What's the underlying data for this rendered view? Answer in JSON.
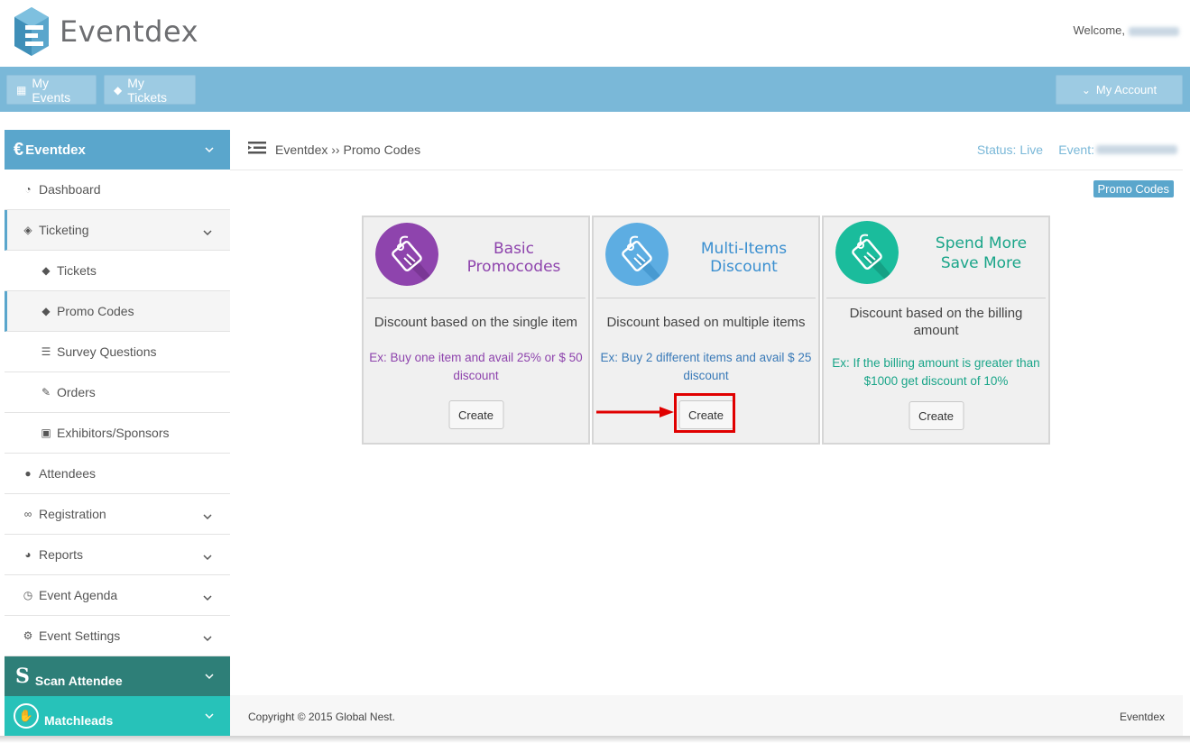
{
  "header": {
    "brand": "Eventdex",
    "welcome": "Welcome,"
  },
  "nav": {
    "my_events": "My Events",
    "my_tickets": "My Tickets",
    "my_account": "My Account"
  },
  "sidebar": {
    "brand": "Eventdex",
    "items": [
      {
        "label": "Dashboard",
        "icon": "dashboard-icon"
      },
      {
        "label": "Ticketing",
        "icon": "ticket-icon"
      },
      {
        "label": "Tickets",
        "icon": "tags-icon"
      },
      {
        "label": "Promo Codes",
        "icon": "tags-icon"
      },
      {
        "label": "Survey Questions",
        "icon": "list-icon"
      },
      {
        "label": "Orders",
        "icon": "edit-icon"
      },
      {
        "label": "Exhibitors/Sponsors",
        "icon": "cube-icon"
      },
      {
        "label": "Attendees",
        "icon": "user-icon"
      },
      {
        "label": "Registration",
        "icon": "link-icon"
      },
      {
        "label": "Reports",
        "icon": "pie-chart-icon"
      },
      {
        "label": "Event Agenda",
        "icon": "clock-icon"
      },
      {
        "label": "Event Settings",
        "icon": "gear-icon"
      }
    ],
    "scan": "Scan Attendee",
    "matchleads": "Matchleads"
  },
  "main": {
    "breadcrumb": "Eventdex ›› Promo Codes",
    "status": "Status: Live",
    "event": "Event:",
    "badge": "Promo Codes",
    "cards": [
      {
        "title": "Basic Promocodes",
        "desc": "Discount based on the single item",
        "example": "Ex: Buy one item and avail 25% or $ 50 discount",
        "button": "Create",
        "color": "#8e44ad"
      },
      {
        "title": "Multi-Items Discount",
        "desc": "Discount based on multiple items",
        "example": "Ex: Buy 2 different items and avail $ 25 discount",
        "button": "Create",
        "color": "#3498db"
      },
      {
        "title": "Spend More Save More",
        "desc": "Discount based on the billing amount",
        "example": "Ex: If the billing amount is greater than $1000 get discount of 10%",
        "button": "Create",
        "color": "#1abc9c"
      }
    ]
  },
  "footer": {
    "copyright": "Copyright © 2015 Global Nest.",
    "brand": "Eventdex"
  }
}
